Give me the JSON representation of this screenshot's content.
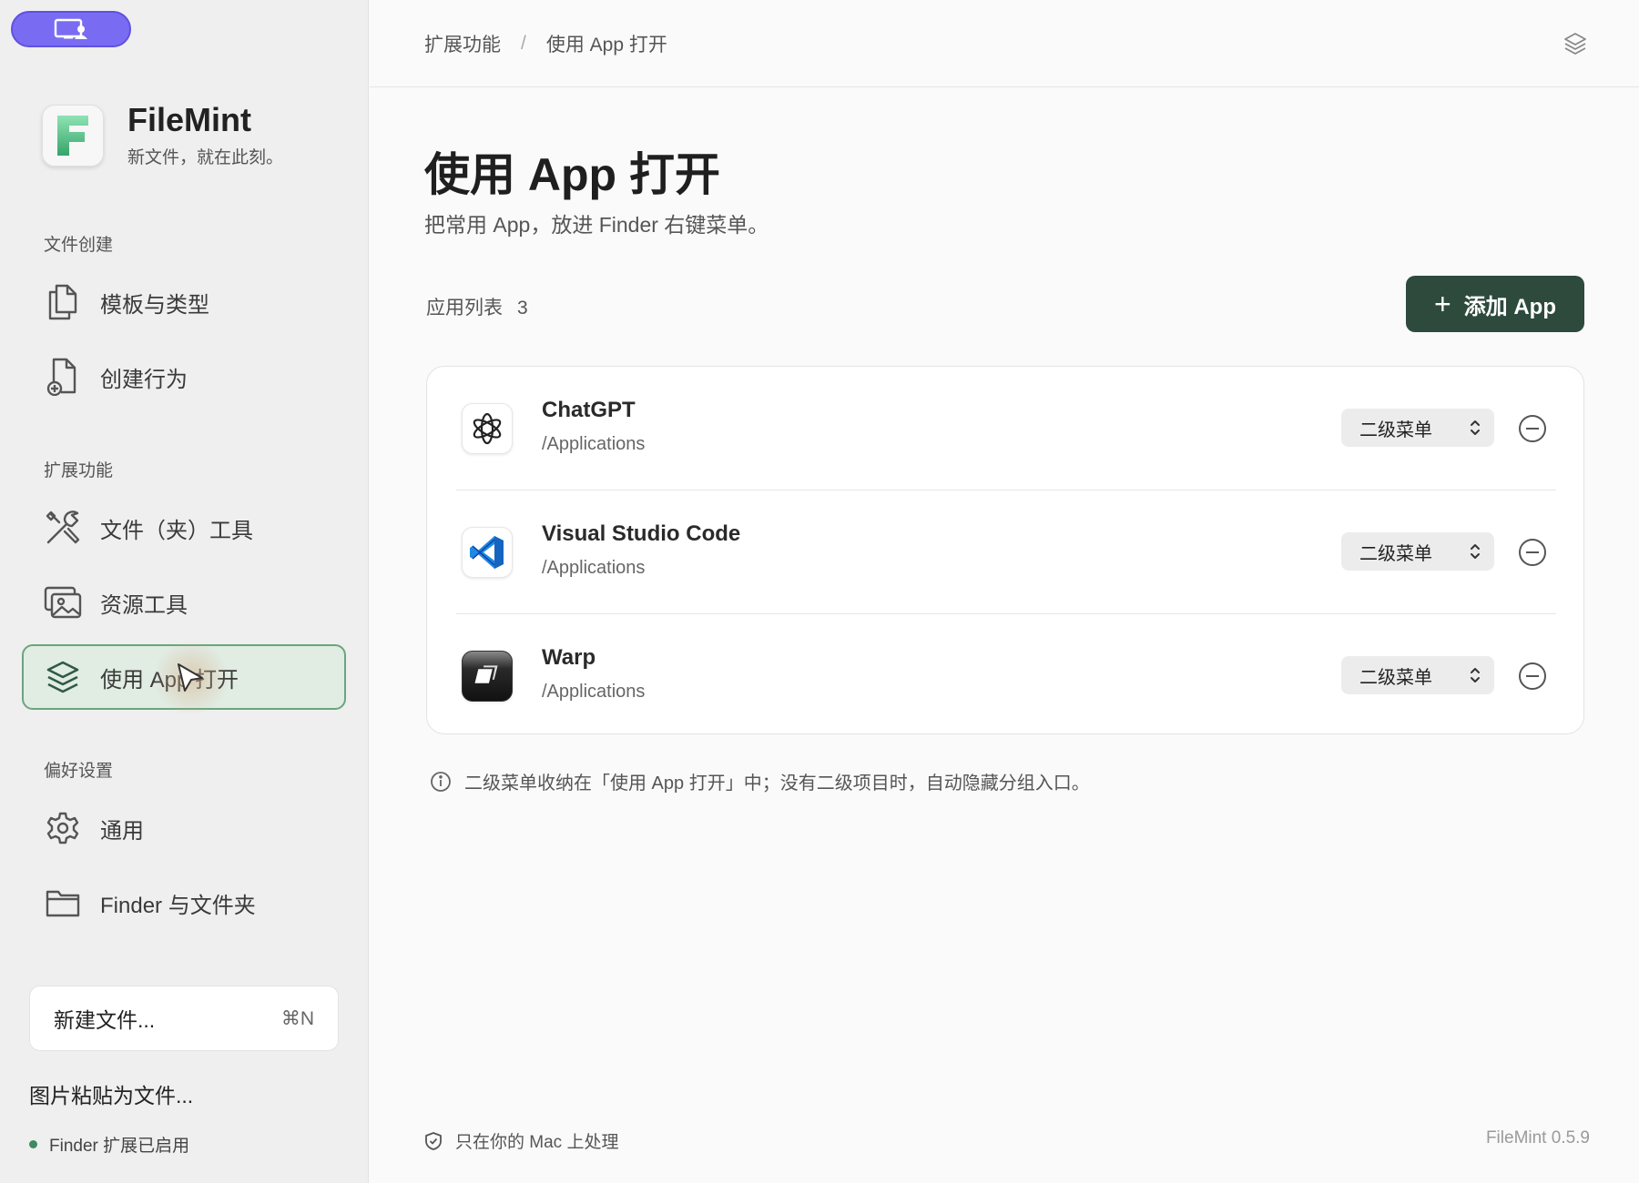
{
  "sidebar": {
    "brand": {
      "name": "FileMint",
      "tagline": "新文件，就在此刻。",
      "logo_letter": "F"
    },
    "sections": {
      "create": "文件创建",
      "extensions": "扩展功能",
      "preferences": "偏好设置"
    },
    "items": [
      {
        "label": "模板与类型",
        "icon": "documents-icon"
      },
      {
        "label": "创建行为",
        "icon": "document-add-icon"
      },
      {
        "label": "文件（夹）工具",
        "icon": "tools-icon"
      },
      {
        "label": "资源工具",
        "icon": "image-icon"
      },
      {
        "label": "使用 App 打开",
        "icon": "layers-icon",
        "active": true
      },
      {
        "label": "通用",
        "icon": "gear-icon"
      },
      {
        "label": "Finder 与文件夹",
        "icon": "folder-icon"
      }
    ],
    "new_file": {
      "label": "新建文件...",
      "shortcut": "⌘N"
    },
    "paste_image": "图片粘贴为文件...",
    "status": "Finder 扩展已启用"
  },
  "header": {
    "breadcrumb": [
      "扩展功能",
      "使用 App 打开"
    ],
    "separator": "/"
  },
  "main": {
    "title": "使用 App 打开",
    "subtitle": "把常用 App，放进 Finder 右键菜单。",
    "list_label": "应用列表",
    "list_count": "3",
    "add_button": {
      "icon": "+",
      "label": "添加 App"
    },
    "apps": [
      {
        "name": "ChatGPT",
        "path": "/Applications",
        "menu": "二级菜单",
        "icon": "chatgpt-icon"
      },
      {
        "name": "Visual Studio Code",
        "path": "/Applications",
        "menu": "二级菜单",
        "icon": "vscode-icon"
      },
      {
        "name": "Warp",
        "path": "/Applications",
        "menu": "二级菜单",
        "icon": "warp-icon"
      }
    ],
    "hint": "二级菜单收纳在「使用 App 打开」中；没有二级项目时，自动隐藏分组入口。"
  },
  "footer": {
    "privacy": "只在你的 Mac 上处理",
    "version": "FileMint 0.5.9"
  },
  "colors": {
    "accent": "#2d4a3d",
    "active_bg": "#e1ece3",
    "active_border": "#6aa57d",
    "top_pill": "#7a6cf2"
  }
}
